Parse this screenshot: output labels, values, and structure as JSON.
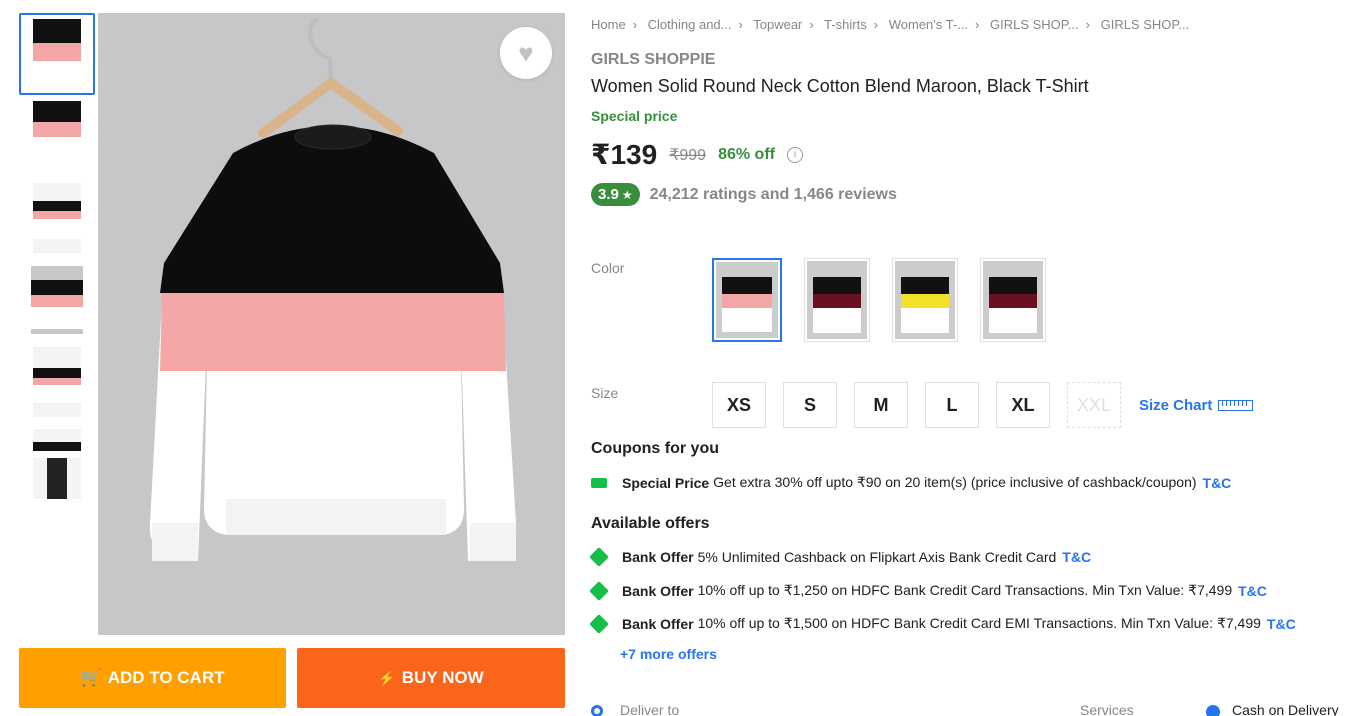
{
  "product": {
    "breadcrumbs": [
      "Home",
      "Clothing and...",
      "Topwear",
      "T-shirts",
      "Women's T-...",
      "GIRLS SHOP...",
      "GIRLS SHOP..."
    ],
    "brand": "GIRLS SHOPPIE",
    "title": "Women Solid Round Neck Cotton Blend Maroon, Black T-Shirt",
    "special_label": "Special price",
    "price": "₹139",
    "mrp": "₹999",
    "discount": "86% off",
    "rating": "3.9",
    "rating_star": "★",
    "rating_summary": "24,212 ratings and 1,466 reviews"
  },
  "gallery": {
    "thumbnail_count": 6,
    "wishlist_icon": "heart-icon"
  },
  "actions": {
    "add_to_cart": "ADD TO CART",
    "buy_now": "BUY NOW",
    "cart_icon": "🛒",
    "bolt_icon": "⚡"
  },
  "variants": {
    "color_label": "Color",
    "colors": [
      {
        "stripe": "#f3a6a6",
        "selected": true
      },
      {
        "stripe": "#6b1020",
        "selected": false
      },
      {
        "stripe": "#f2e12a",
        "selected": false
      },
      {
        "stripe": "#6b1020",
        "selected": false
      }
    ],
    "size_label": "Size",
    "sizes": [
      "XS",
      "S",
      "M",
      "L",
      "XL",
      "XXL"
    ],
    "disabled_size": "XXL",
    "size_chart": "Size Chart"
  },
  "coupons": {
    "heading": "Coupons for you",
    "items": [
      {
        "type": "Special Price",
        "text": "Get extra 30% off upto ₹90 on 20 item(s) (price inclusive of cashback/coupon)",
        "tc": "T&C"
      }
    ]
  },
  "offers": {
    "heading": "Available offers",
    "items": [
      {
        "type": "Bank Offer",
        "text": "5% Unlimited Cashback on Flipkart Axis Bank Credit Card",
        "tc": "T&C"
      },
      {
        "type": "Bank Offer",
        "text": "10% off up to ₹1,250 on HDFC Bank Credit Card Transactions. Min Txn Value: ₹7,499",
        "tc": "T&C"
      },
      {
        "type": "Bank Offer",
        "text": "10% off up to ₹1,500 on HDFC Bank Credit Card EMI Transactions. Min Txn Value: ₹7,499",
        "tc": "T&C"
      }
    ],
    "more": "+7 more offers"
  },
  "delivery": {
    "deliver_to": "Deliver to",
    "services": "Services",
    "cod": "Cash on Delivery"
  },
  "colors": {
    "accent": "#2874f0",
    "green": "#388e3c",
    "cart": "#ff9f00",
    "buy": "#fb641b"
  }
}
